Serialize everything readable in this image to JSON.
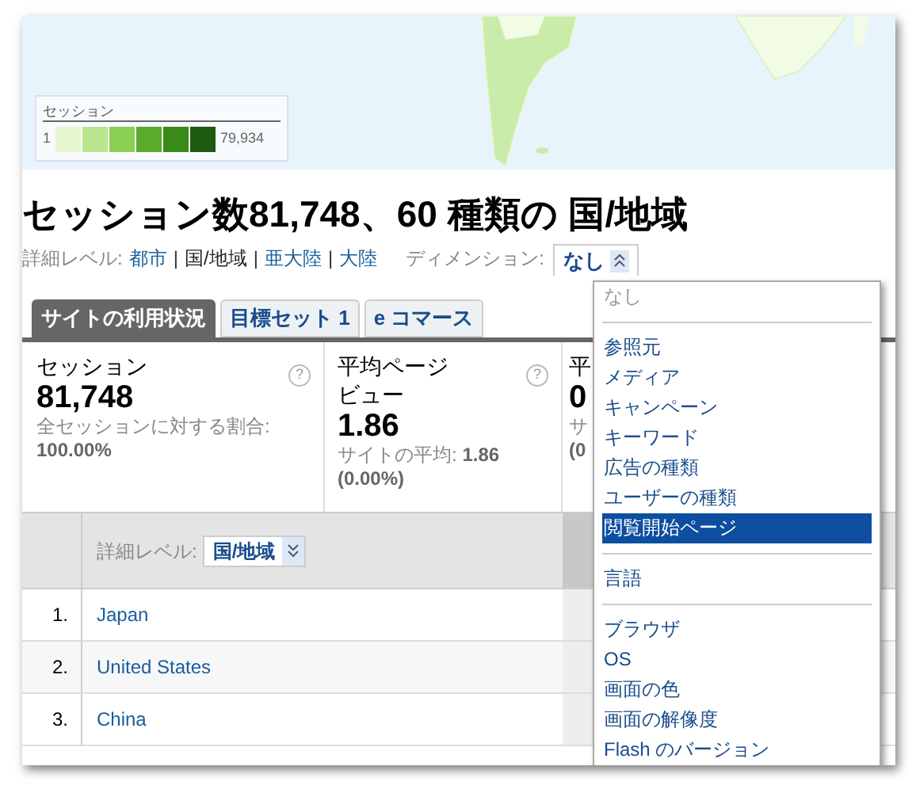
{
  "map": {
    "kind": "picture",
    "legend": {
      "title": "セッション",
      "min": "1",
      "max": "79,934"
    }
  },
  "title": "セッション数81,748、60 種類の 国/地域",
  "detail_level": {
    "label": "詳細レベル:",
    "separator": "|",
    "options": [
      {
        "label": "都市",
        "selected": false
      },
      {
        "label": "国/地域",
        "selected": true
      },
      {
        "label": "亜大陸",
        "selected": false
      },
      {
        "label": "大陸",
        "selected": false
      }
    ]
  },
  "dimension": {
    "label": "ディメンション:",
    "value": "なし",
    "menu": [
      [
        {
          "label": "なし",
          "disabled": true,
          "selected": false
        }
      ],
      [
        {
          "label": "参照元",
          "disabled": false,
          "selected": false
        },
        {
          "label": "メディア",
          "disabled": false,
          "selected": false
        },
        {
          "label": "キャンペーン",
          "disabled": false,
          "selected": false
        },
        {
          "label": "キーワード",
          "disabled": false,
          "selected": false
        },
        {
          "label": "広告の種類",
          "disabled": false,
          "selected": false
        },
        {
          "label": "ユーザーの種類",
          "disabled": false,
          "selected": false
        },
        {
          "label": "閲覧開始ページ",
          "disabled": false,
          "selected": true
        }
      ],
      [
        {
          "label": "言語",
          "disabled": false,
          "selected": false
        }
      ],
      [
        {
          "label": "ブラウザ",
          "disabled": false,
          "selected": false
        },
        {
          "label": "OS",
          "disabled": false,
          "selected": false
        },
        {
          "label": "画面の色",
          "disabled": false,
          "selected": false
        },
        {
          "label": "画面の解像度",
          "disabled": false,
          "selected": false
        },
        {
          "label": "Flash のバージョン",
          "disabled": false,
          "selected": false
        }
      ]
    ]
  },
  "tabs": [
    {
      "label": "サイトの利用状況",
      "selected": true
    },
    {
      "label": "目標セット 1",
      "selected": false
    },
    {
      "label": "e コマース",
      "selected": false
    }
  ],
  "metrics": [
    {
      "label": "セッション",
      "value": "81,748",
      "note": "全セッションに対する割合:",
      "note_value": "100.00%",
      "help": "?"
    },
    {
      "label": "平均ページビュー",
      "value": "1.86",
      "note": "サイトの平均:",
      "note_value": "1.86",
      "note_extra": "(0.00%)",
      "help": "?"
    },
    {
      "label": "平",
      "value": "0",
      "note": "サ",
      "note_value": "(0"
    }
  ],
  "table": {
    "detail_label": "詳細レベル:",
    "detail_value": "国/地域",
    "rows": [
      {
        "rank": "1.",
        "name": "Japan"
      },
      {
        "rank": "2.",
        "name": "United States"
      },
      {
        "rank": "3.",
        "name": "China"
      }
    ]
  }
}
